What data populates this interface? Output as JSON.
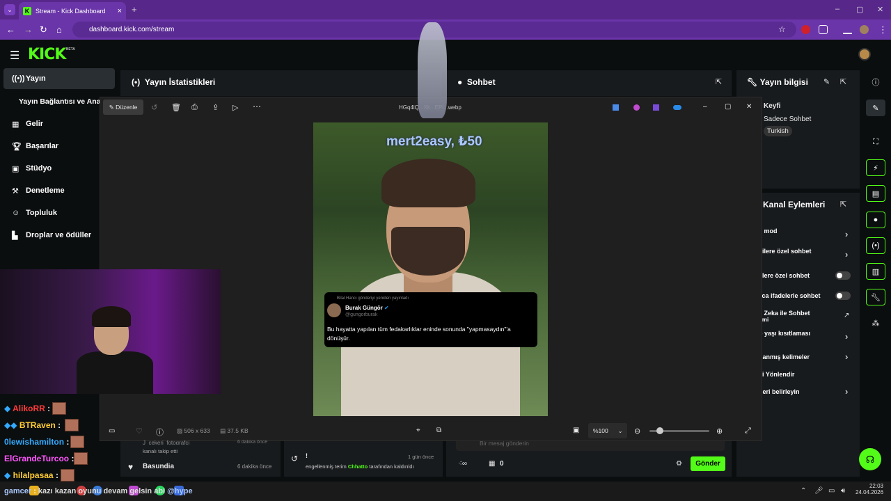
{
  "browser": {
    "tab_title": "Stream - Kick Dashboard",
    "url": "dashboard.kick.com/stream",
    "new_tab": "+",
    "tab_close": "×"
  },
  "kick": {
    "logo": "KICK",
    "beta": "BETA"
  },
  "sidebar": {
    "items": [
      {
        "label": "Yayın",
        "icon": "broadcast-icon"
      },
      {
        "label": "Yayın Bağlantısı ve Ana",
        "icon": ""
      },
      {
        "label": "Gelir",
        "icon": "revenue-icon"
      },
      {
        "label": "Başarılar",
        "icon": "trophy-icon"
      },
      {
        "label": "Stüdyo",
        "icon": "studio-icon"
      },
      {
        "label": "Denetleme",
        "icon": "hammer-icon"
      },
      {
        "label": "Topluluk",
        "icon": "community-icon"
      },
      {
        "label": "Droplar ve ödüller",
        "icon": "drops-icon"
      }
    ]
  },
  "panels": {
    "stats_title": "Yayın İstatistikleri",
    "chat_title": "Sohbet",
    "info_title": "Yayın bilgisi",
    "info_category": "Keyfi",
    "info_mode": "Sadece Sohbet",
    "info_lang_tag": "Turkish",
    "actions_title": "Kanal Eylemleri",
    "actions": [
      "ş mod",
      "cilere özel sohbet",
      "elere özel sohbet",
      "zca ifadelerle sohbet",
      "y Zeka ile Sohbet",
      "timi",
      "o yaşı kısıtlaması",
      "danmış kelimeler",
      "ci Yönlendir",
      "fleri belirleyin"
    ]
  },
  "viewer": {
    "edit_label": "Düzenle",
    "filename": "HGq4lQ...Xk...EPi...webp",
    "overlay_text": "mert2easy, ₺50",
    "dimensions": "506 x 633",
    "filesize": "37.5 KB",
    "zoom": "%100",
    "tweet_repost": "Bilal Hancı gönderiyi yeniden yayınladı",
    "tweet_name": "Burak Güngör",
    "tweet_handle": "@gungorburak",
    "tweet_text": "Bu hayatta yapılan tüm fedakarlıklar eninde sonunda \"yapmasaydın\"'a dönüşür."
  },
  "activity": {
    "row1_name": "Basundia",
    "row1_time": "6 dakika önce",
    "row0_time": "6 dakika önce",
    "row0_sub": "kanalı takip etti",
    "log_time": "1 gün önce",
    "log_mark": "!",
    "log_text_pre": "engellenmiş terim ",
    "log_user": "Chhatto",
    "log_text_post": " tarafından kaldırıldı",
    "chat_placeholder": "Bir mesaj gönderin",
    "counter": "0",
    "send": "Gönder"
  },
  "feed": [
    {
      "name": "AlikoRR",
      "color": "#ff3b3b"
    },
    {
      "name": "BTRaven",
      "color": "#ffcc33"
    },
    {
      "name": "0lewishamilton",
      "color": "#33aaff"
    },
    {
      "name": "ElGrandeTurcoo",
      "color": "#ff55ff"
    },
    {
      "name": "hilalpasaa",
      "color": "#ffffff"
    }
  ],
  "ticker": "kazı kazan oyunu devam gelsin abi",
  "ticker_prefix": "gamcer",
  "ticker_suffix": "@hype",
  "clock": {
    "time": "22:03",
    "date": "24.04.2026"
  }
}
